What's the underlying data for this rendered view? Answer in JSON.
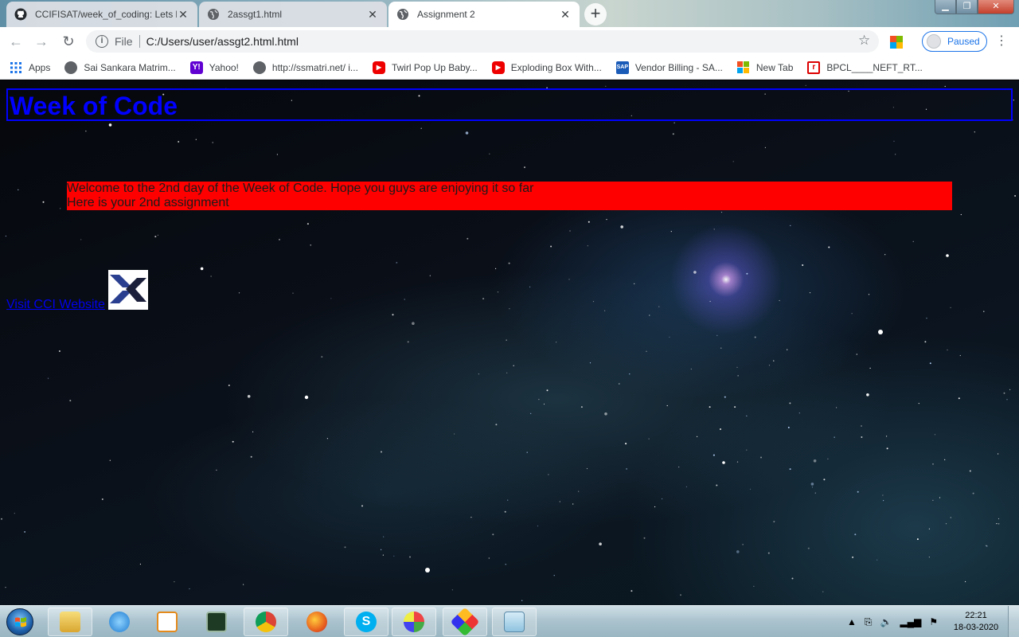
{
  "browser": {
    "tabs": [
      {
        "title": "CCIFISAT/week_of_coding: Lets le",
        "icon": "github-icon",
        "active": false
      },
      {
        "title": "2assgt1.html",
        "icon": "globe-icon",
        "active": false
      },
      {
        "title": "Assignment 2",
        "icon": "globe-icon",
        "active": true
      }
    ],
    "new_tab_label": "+",
    "address": {
      "scheme_label": "File",
      "url": "C:/Users/user/assgt2.html.html"
    },
    "profile_label": "Paused",
    "bookmarks": [
      {
        "label": "Apps",
        "icon": "apps-grid-icon"
      },
      {
        "label": "Sai Sankara Matrim...",
        "icon": "globe-icon"
      },
      {
        "label": "Yahoo!",
        "icon": "yahoo-icon"
      },
      {
        "label": "http://ssmatri.net/ i...",
        "icon": "globe-icon"
      },
      {
        "label": "Twirl Pop Up Baby...",
        "icon": "youtube-icon"
      },
      {
        "label": "Exploding Box With...",
        "icon": "youtube-icon"
      },
      {
        "label": "Vendor Billing - SA...",
        "icon": "sap-icon"
      },
      {
        "label": "New Tab",
        "icon": "windows-tiles-icon"
      },
      {
        "label": "BPCL____NEFT_RT...",
        "icon": "bpcl-icon"
      }
    ]
  },
  "page": {
    "heading": "Week of Code",
    "notice_line1": "Welcome to the 2nd day of the Week of Code. Hope you guys are enjoying it so far",
    "notice_line2": "Here is your 2nd assignment",
    "link_text": "Visit CCI Website",
    "colors": {
      "heading": "#0000ff",
      "notice_bg": "#ff0000",
      "link": "#0000ee"
    }
  },
  "taskbar": {
    "apps": [
      "file-explorer-icon",
      "internet-explorer-icon",
      "media-player-icon",
      "task-manager-icon",
      "chrome-icon",
      "firefox-icon",
      "skype-icon",
      "paint-icon",
      "snipping-tool-icon",
      "notepad-icon"
    ],
    "time": "22:21",
    "date": "18-03-2020"
  }
}
